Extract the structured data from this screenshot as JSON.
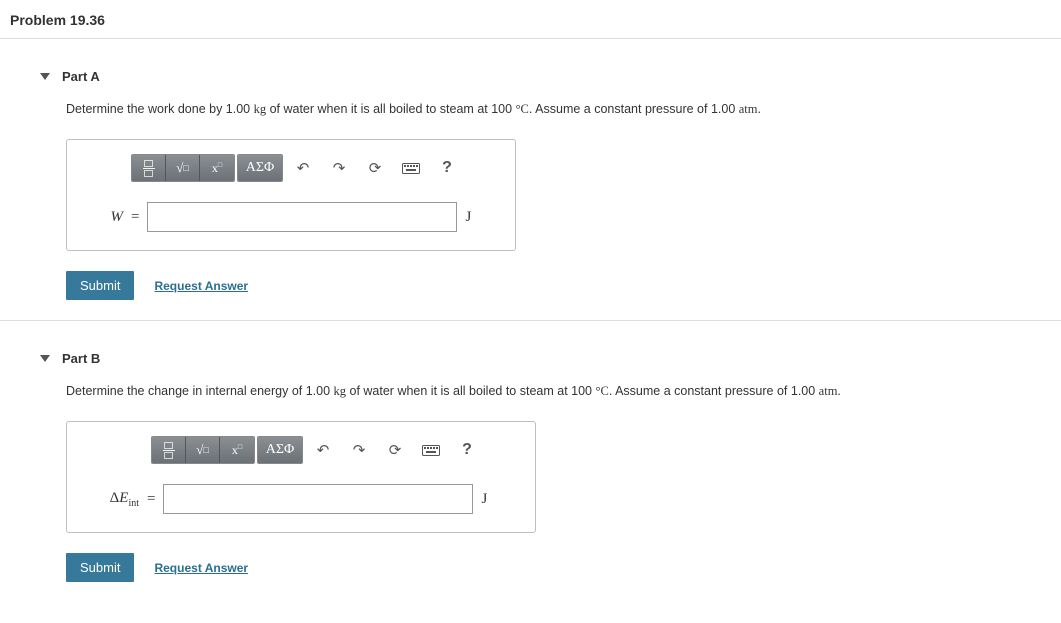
{
  "problem": {
    "title": "Problem 19.36"
  },
  "parts": {
    "A": {
      "label": "Part A",
      "prompt_pre": "Determine the work done by 1.00 ",
      "prompt_kg": "kg",
      "prompt_mid1": " of water when it is all boiled to steam at 100 ",
      "prompt_deg": "°C",
      "prompt_mid2": ". Assume a constant pressure of 1.00 ",
      "prompt_atm": "atm",
      "prompt_end": ".",
      "var": "W",
      "unit": "J",
      "submit": "Submit",
      "request": "Request Answer"
    },
    "B": {
      "label": "Part B",
      "prompt_pre": "Determine the change in internal energy of 1.00 ",
      "prompt_kg": "kg",
      "prompt_mid1": " of water when it is all boiled to steam at 100 ",
      "prompt_deg": "°C",
      "prompt_mid2": ". Assume a constant pressure of 1.00 ",
      "prompt_atm": "atm",
      "prompt_end": ".",
      "var_html": "ΔE",
      "var_sub": "int",
      "unit": "J",
      "submit": "Submit",
      "request": "Request Answer"
    }
  },
  "toolbar": {
    "greek": "ΑΣΦ",
    "help": "?"
  }
}
